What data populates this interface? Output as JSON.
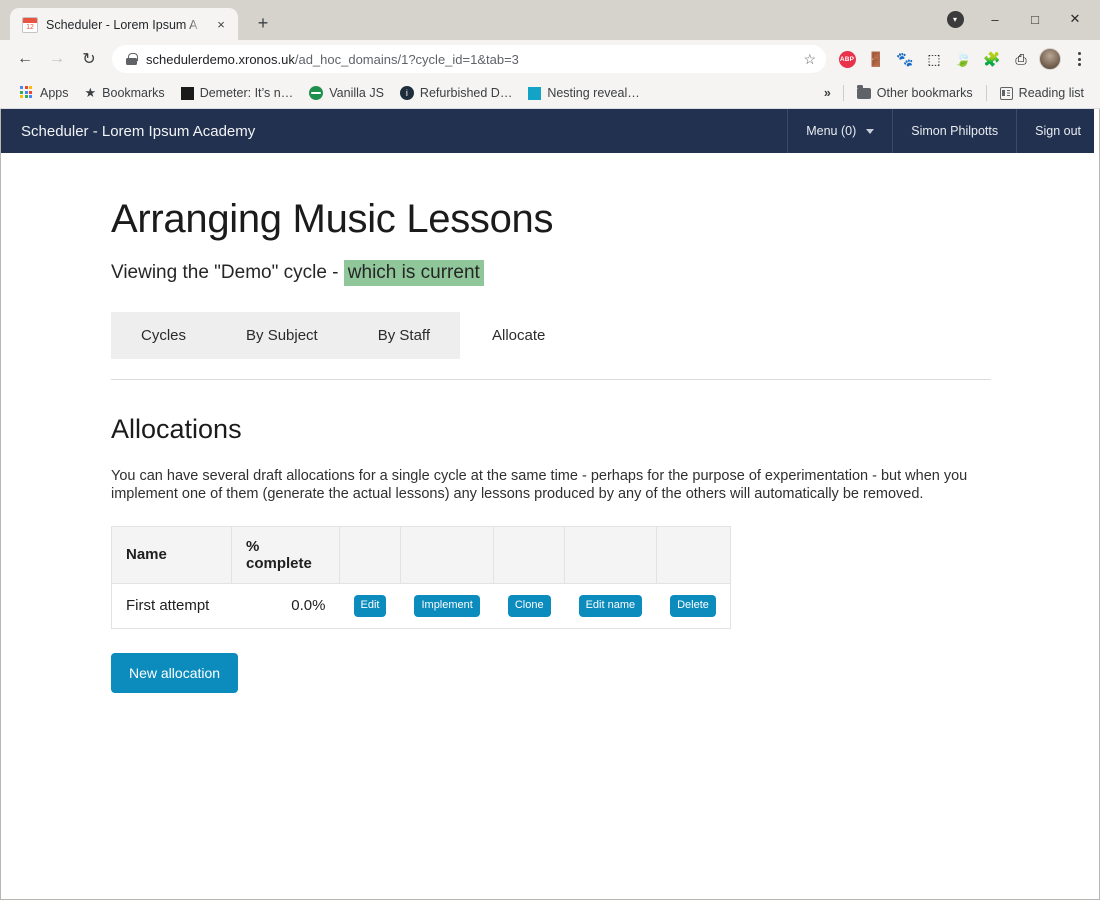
{
  "browser": {
    "tab": {
      "title": "Scheduler - Lorem Ipsum A",
      "favicon": "calendar-icon",
      "favicon_day": "12",
      "close_label": "×"
    },
    "new_tab_label": "+",
    "window_controls": {
      "download_label": "▾",
      "minimize_label": "–",
      "maximize_label": "□",
      "close_label": "✕"
    },
    "nav": {
      "back_label": "←",
      "forward_label": "→",
      "reload_label": "↻"
    },
    "omnibox": {
      "lock": "lock-icon",
      "url_domain": "schedulerdemo.xronos.uk",
      "url_path": "/ad_hoc_domains/1?cycle_id=1&tab=3",
      "star_label": "☆"
    },
    "extensions": [
      {
        "name": "adblock-plus-icon",
        "label": "ABP"
      },
      {
        "name": "door-key-icon",
        "label": "🚪"
      },
      {
        "name": "gnome-footprint-icon",
        "label": "🐾"
      },
      {
        "name": "screenshot-frame-icon",
        "label": "⬚"
      },
      {
        "name": "leaf-icon",
        "label": "🍃"
      },
      {
        "name": "extensions-puzzle-icon",
        "label": "🧩"
      },
      {
        "name": "cast-icon",
        "label": "⎙"
      }
    ],
    "bookmarks": [
      {
        "name": "apps-shortcut",
        "label": "Apps",
        "icon": "apps-grid-icon"
      },
      {
        "name": "bookmarks-folder",
        "label": "Bookmarks",
        "icon": "star-icon"
      },
      {
        "name": "demeter-bookmark",
        "label": "Demeter: It’s n…",
        "icon": "black-square-icon"
      },
      {
        "name": "vanilla-js-bookmark",
        "label": "Vanilla JS",
        "icon": "globe-icon"
      },
      {
        "name": "refurbished-bookmark",
        "label": "Refurbished D…",
        "icon": "info-circle-icon"
      },
      {
        "name": "nesting-bookmark",
        "label": "Nesting reveal…",
        "icon": "teal-square-icon"
      }
    ],
    "bookmarks_overflow_label": "»",
    "other_bookmarks_label": "Other bookmarks",
    "reading_list_label": "Reading list"
  },
  "app": {
    "navbar": {
      "brand": "Scheduler - Lorem Ipsum Academy",
      "menu_label": "Menu (0)",
      "user_label": "Simon Philpotts",
      "signout_label": "Sign out"
    },
    "page_title": "Arranging Music Lessons",
    "subtitle_prefix": "Viewing the \"Demo\" cycle - ",
    "subtitle_highlight": "which is current",
    "tabs": [
      {
        "label": "Cycles",
        "active": false
      },
      {
        "label": "By Subject",
        "active": false
      },
      {
        "label": "By Staff",
        "active": false
      },
      {
        "label": "Allocate",
        "active": true
      }
    ],
    "section": {
      "title": "Allocations",
      "description": "You can have several draft allocations for a single cycle at the same time - perhaps for the purpose of experimentation - but when you implement one of them (generate the actual lessons) any lessons produced by any of the others will automatically be removed."
    },
    "table": {
      "headers": [
        "Name",
        "% complete",
        "",
        "",
        "",
        "",
        ""
      ],
      "rows": [
        {
          "name": "First attempt",
          "percent_complete": "0.0%",
          "actions": [
            "Edit",
            "Implement",
            "Clone",
            "Edit name",
            "Delete"
          ]
        }
      ]
    },
    "new_allocation_label": "New allocation",
    "colors": {
      "navbar": "#22314f",
      "button": "#0c8bbd",
      "highlight": "#90c79a"
    }
  }
}
